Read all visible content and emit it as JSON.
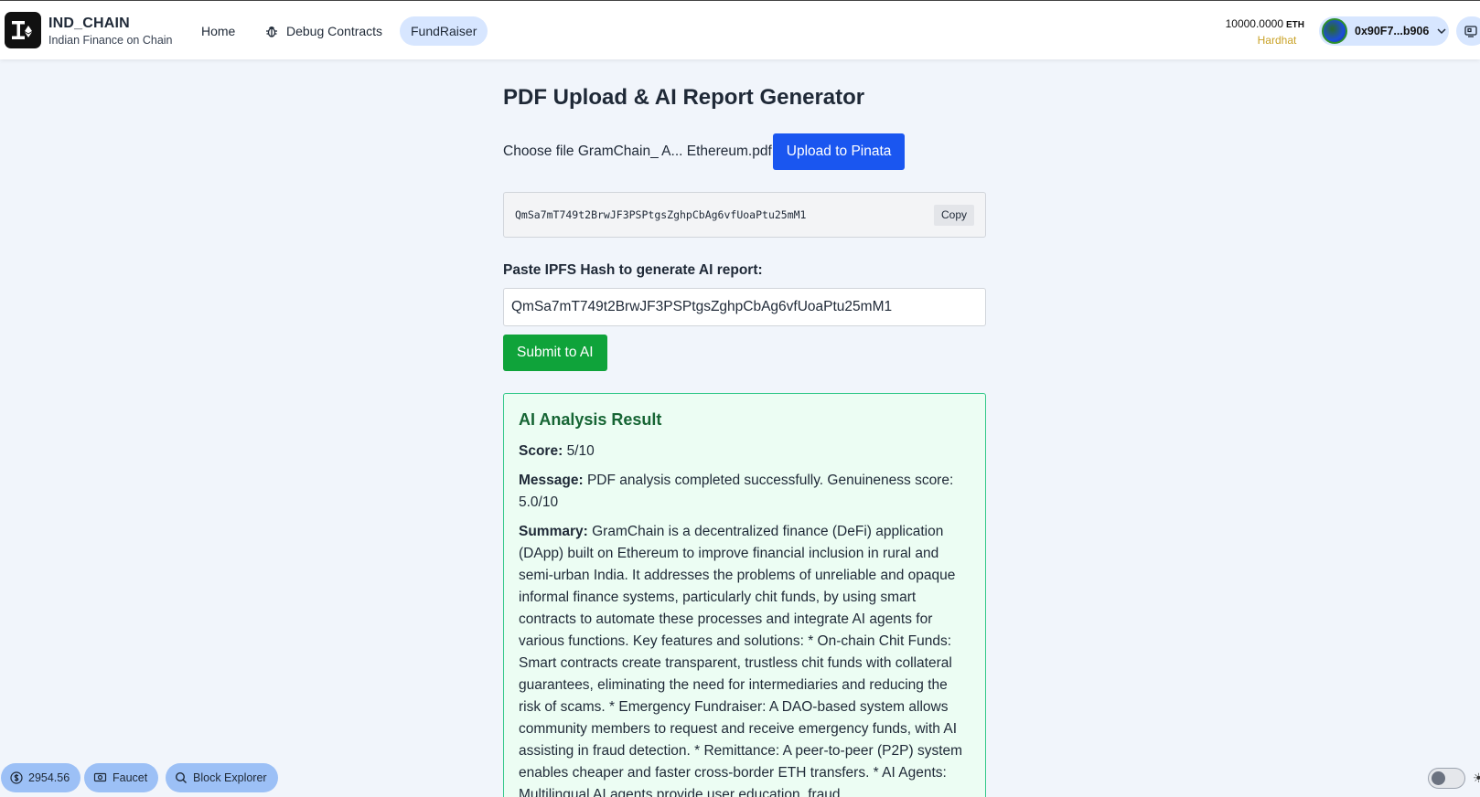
{
  "brand": {
    "title": "IND_CHAIN",
    "subtitle": "Indian Finance on Chain"
  },
  "nav": {
    "home": "Home",
    "debug": "Debug Contracts",
    "fundraiser": "FundRaiser"
  },
  "wallet": {
    "balance": "10000.0000",
    "unit": "ETH",
    "network": "Hardhat",
    "address": "0x90F7...b906"
  },
  "page": {
    "title": "PDF Upload & AI Report Generator",
    "file_label": "Choose file GramChain_ A... Ethereum.pdf",
    "upload_button": "Upload to Pinata",
    "ipfs_hash": "QmSa7mT749t2BrwJF3PSPtgsZghpCbAg6vfUoaPtu25mM1",
    "copy_button": "Copy",
    "paste_label": "Paste IPFS Hash to generate AI report:",
    "hash_input_value": "QmSa7mT749t2BrwJF3PSPtgsZghpCbAg6vfUoaPtu25mM1",
    "submit_button": "Submit to AI"
  },
  "result": {
    "title": "AI Analysis Result",
    "score_label": "Score:",
    "score_value": "5/10",
    "message_label": "Message:",
    "message_value": "PDF analysis completed successfully. Genuineness score: 5.0/10",
    "summary_label": "Summary:",
    "summary_value": "GramChain is a decentralized finance (DeFi) application (DApp) built on Ethereum to improve financial inclusion in rural and semi-urban India. It addresses the problems of unreliable and opaque informal finance systems, particularly chit funds, by using smart contracts to automate these processes and integrate AI agents for various functions. Key features and solutions: * On-chain Chit Funds: Smart contracts create transparent, trustless chit funds with collateral guarantees, eliminating the need for intermediaries and reducing the risk of scams. * Emergency Fundraiser: A DAO-based system allows community members to request and receive emergency funds, with AI assisting in fraud detection. * Remittance: A peer-to-peer (P2P) system enables cheaper and faster cross-border ETH transfers. * AI Agents: Multilingual AI agents provide user education, fraud"
  },
  "footer": {
    "price": "2954.56",
    "faucet": "Faucet",
    "explorer": "Block Explorer"
  }
}
